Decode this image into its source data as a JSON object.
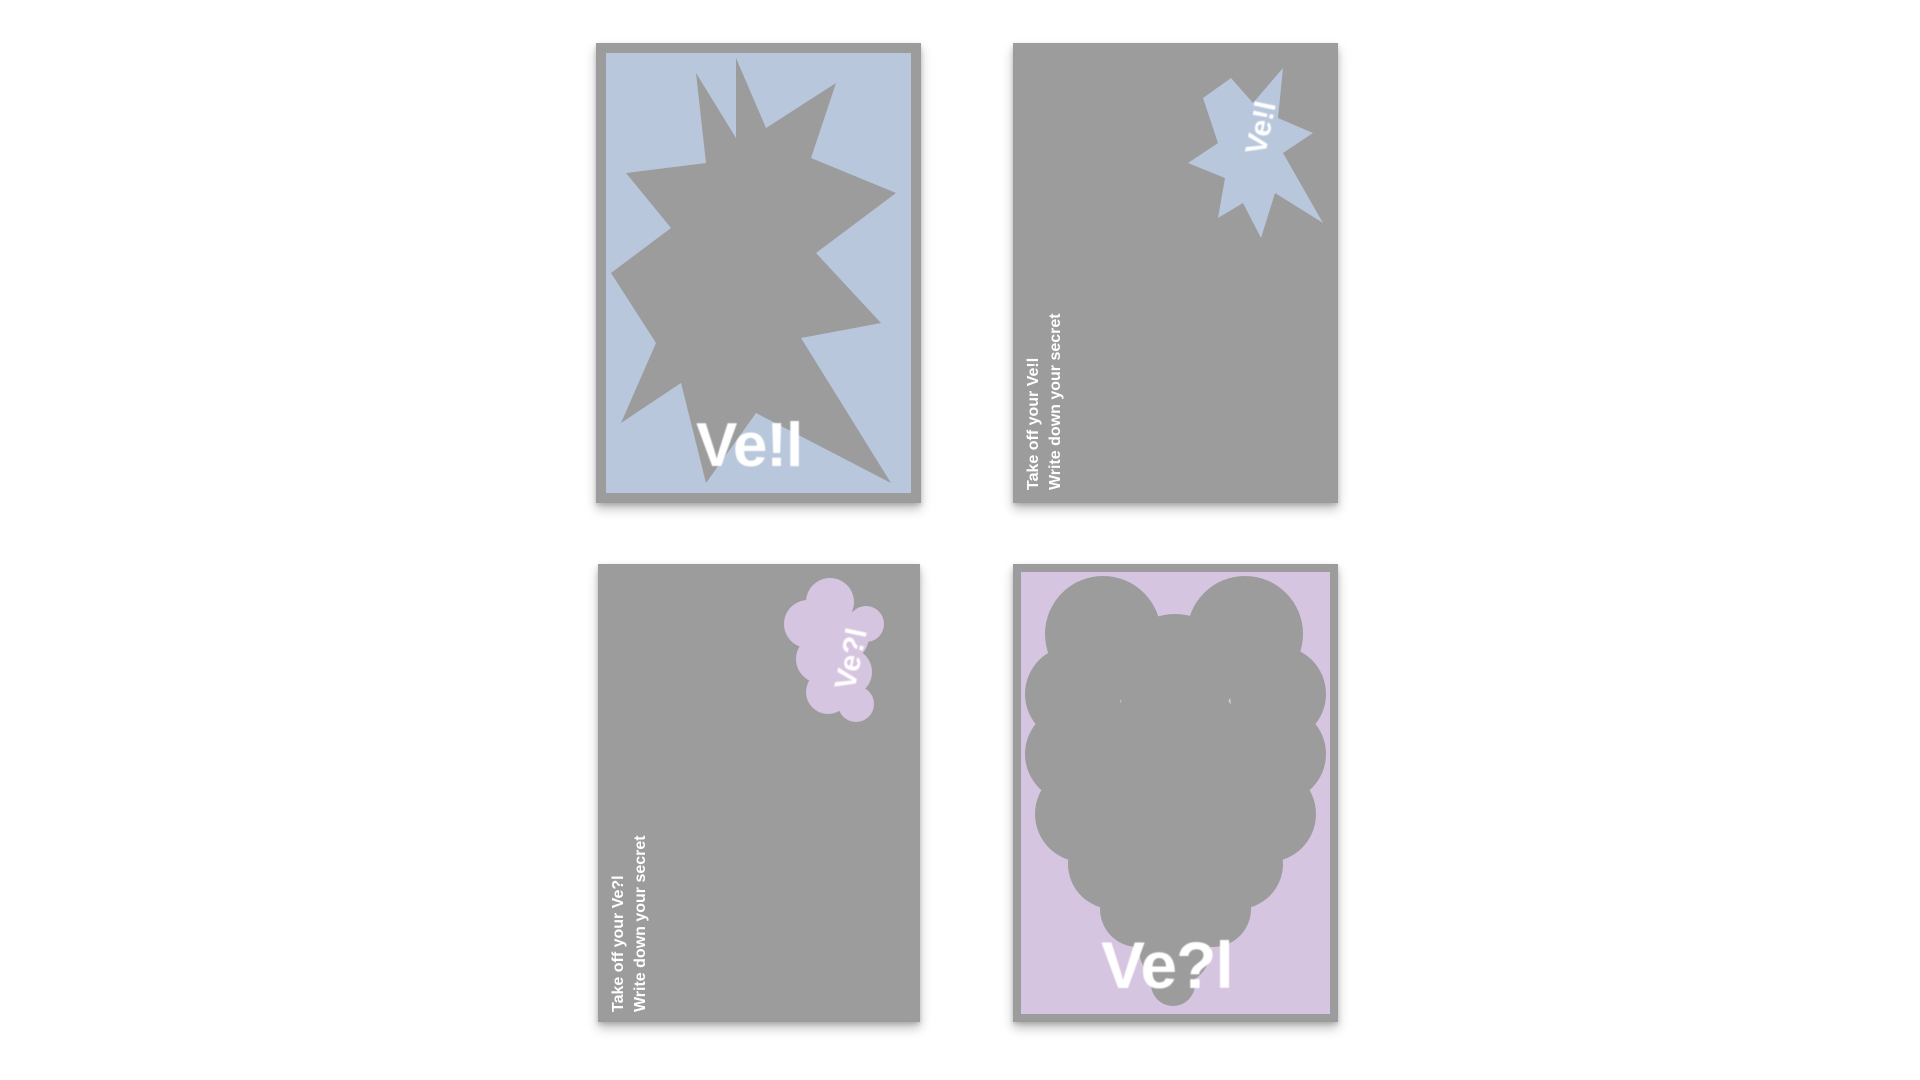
{
  "cards": [
    {
      "logo": "Ve!l",
      "shape": "starburst-icon",
      "color": "#b8c7dc"
    },
    {
      "logo": "Ve!l",
      "shape": "starburst-icon",
      "color": "#b8c7dc",
      "line1": "Take off your Ve!l",
      "line2": "Write down your secret"
    },
    {
      "logo": "Ve?l",
      "shape": "cloud-icon",
      "color": "#d6c5e0",
      "line1": "Take off your Ve?l",
      "line2": "Write down your secret"
    },
    {
      "logo": "Ve?l",
      "shape": "cloud-icon",
      "color": "#d6c5e0"
    }
  ],
  "colors": {
    "card_gray": "#9c9c9c",
    "blue": "#b8c7dc",
    "lavender": "#d6c5e0",
    "background": "#ffffff"
  }
}
